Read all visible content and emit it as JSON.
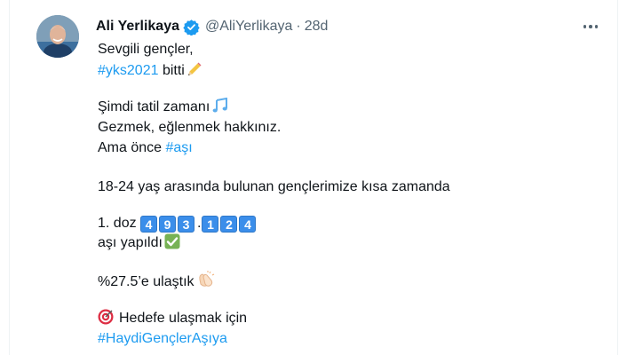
{
  "tweet": {
    "author_name": "Ali Yerlikaya",
    "handle": "@AliYerlikaya",
    "separator": "·",
    "time": "28d",
    "line1": "Sevgili gençler,",
    "hashtag_yks": "#yks2021",
    "line2_rest": " bitti",
    "line3": "Şimdi tatil zamanı",
    "line4": "Gezmek, eğlenmek hakkınız.",
    "line5_prefix": "Ama önce ",
    "hashtag_asi": "#aşı",
    "line6": "18-24 yaş arasında bulunan gençlerimize kısa zamanda",
    "line7_prefix": "1. doz ",
    "digits_group1": [
      "4",
      "9",
      "3"
    ],
    "digits_dot": ".",
    "digits_group2": [
      "1",
      "2",
      "4"
    ],
    "line8": "aşı yapıldı",
    "line9": "%27.5’e ulaştık",
    "line10": "Hedefe ulaşmak için",
    "hashtag_haydi": "#HaydiGençlerAşıya"
  },
  "icons": {
    "verified": "verified-badge-icon",
    "more": "more-options-icon",
    "pencil": "pencil-emoji",
    "music": "music-notes-emoji",
    "check": "check-mark-emoji",
    "clap": "clapping-hands-emoji",
    "target": "direct-hit-emoji"
  },
  "colors": {
    "link": "#1d9bf0",
    "text": "#0f1419",
    "secondary": "#536471",
    "keycap": "#3b8eea",
    "check": "#77b255"
  }
}
